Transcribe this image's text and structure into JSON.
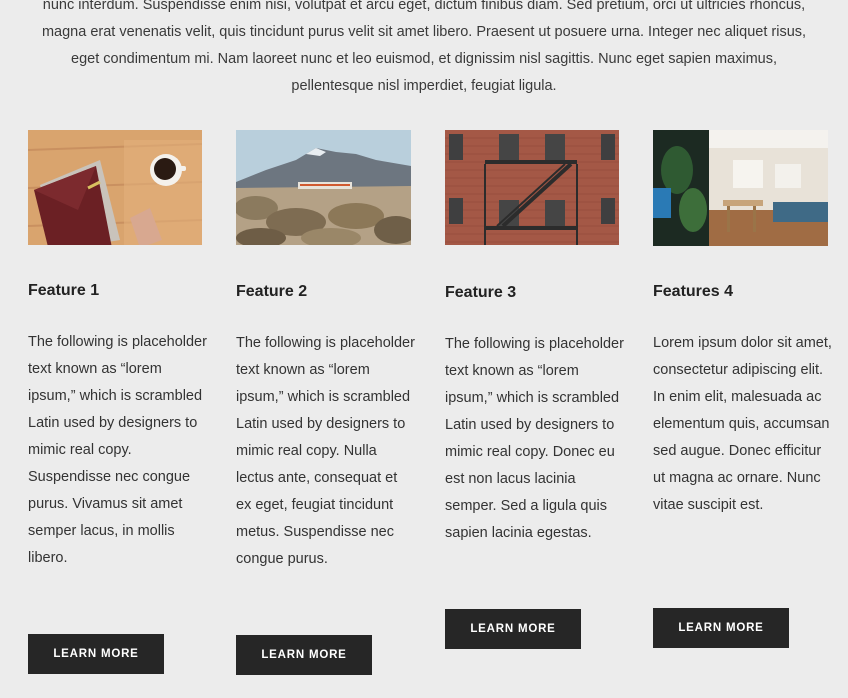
{
  "intro": {
    "text": "nunc interdum. Suspendisse enim nisi, volutpat et arcu eget, dictum finibus diam. Sed pretium, orci ut ultricies rhoncus, magna erat venenatis velit, quis tincidunt purus velit sit amet libero. Praesent ut posuere urna. Integer nec aliquet risus, eget condimentum mi. Nam laoreet nunc et leo euismod, et dignissim nisl sagittis. Nunc eget sapien maximus, pellentesque nisl imperdiet, feugiat ligula."
  },
  "features": [
    {
      "title": "Feature 1",
      "body": "The following is placeholder text known as “lorem ipsum,” which is scrambled Latin used by designers to mimic real copy. Suspendisse nec congue purus. Vivamus sit amet semper lacus, in mollis libero.",
      "button": "LEARN MORE"
    },
    {
      "title": "Feature 2",
      "body": "The following is placeholder text known as “lorem ipsum,” which is scrambled Latin used by designers to mimic real copy. Nulla lectus ante, consequat et ex eget, feugiat tincidunt metus. Suspendisse nec congue purus.",
      "button": "LEARN MORE"
    },
    {
      "title": "Feature 3",
      "body": "The following is placeholder text known as “lorem ipsum,” which is scrambled Latin used by designers to mimic real copy. Donec eu est non lacus lacinia semper. Sed a ligula quis sapien lacinia egestas.",
      "button": "LEARN MORE"
    },
    {
      "title": "Features 4",
      "body": "Lorem ipsum dolor sit amet, consectetur adipiscing elit. In enim elit, malesuada ac elementum quis, accumsan sed augue. Donec efficitur ut magna ac ornare. Nunc vitae suscipit est.",
      "button": "LEARN MORE"
    }
  ],
  "colors": {
    "background": "#ececec",
    "button": "#262626",
    "button_text": "#ffffff",
    "text": "#333333"
  }
}
